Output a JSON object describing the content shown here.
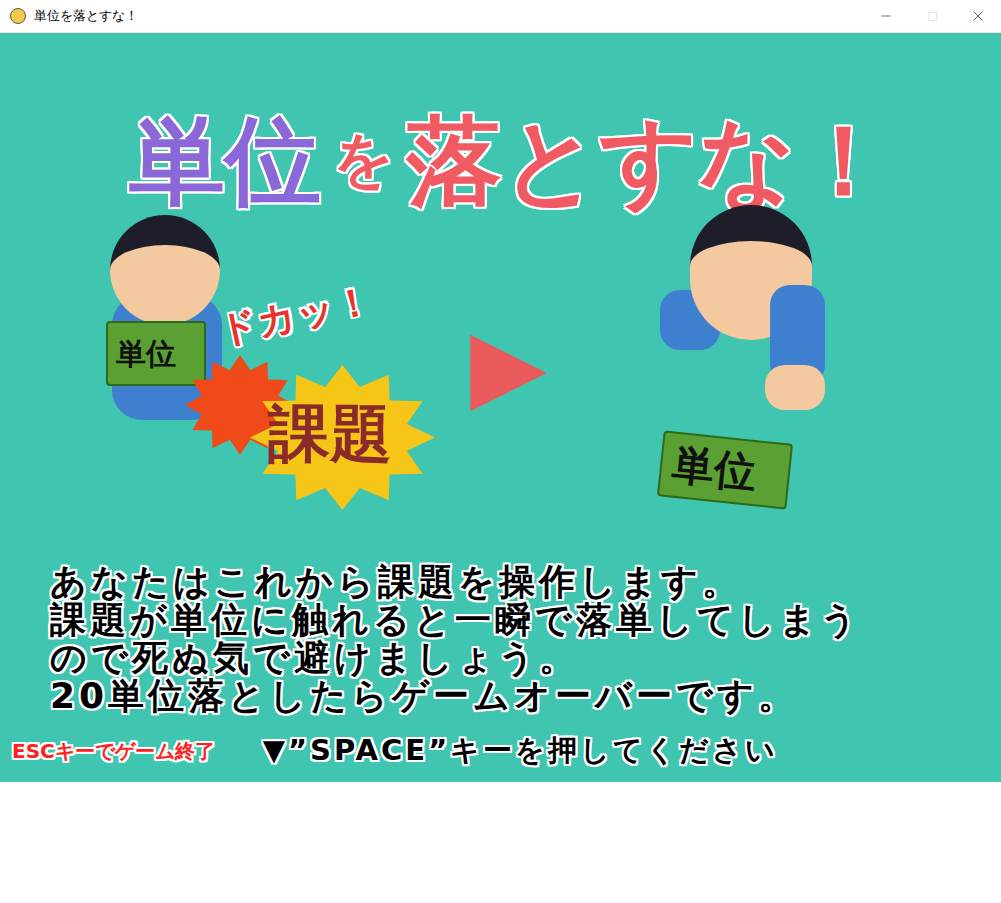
{
  "window": {
    "title": "単位を落とすな！"
  },
  "title": {
    "parts": [
      {
        "text": "単位",
        "color": "#8b68d8",
        "kind": "large"
      },
      {
        "text": "を",
        "color": "#ef5a63",
        "kind": "small"
      },
      {
        "text": "落とすな！",
        "color": "#ef5a63",
        "kind": "large"
      }
    ]
  },
  "illustration": {
    "left": {
      "card": "単位",
      "impact": "ドカッ！",
      "assignment": "課題"
    },
    "arrow": "▶",
    "right": {
      "card": "単位"
    }
  },
  "instructions": [
    "あなたはこれから課題を操作します。",
    "課題が単位に触れると一瞬で落単してしまう",
    "ので死ぬ気で避けましょう。",
    "20単位落としたらゲームオーバーです。"
  ],
  "footer": {
    "quit": "ESCキーでゲーム終了",
    "prompt": "▼”SPACE”キーを押してください"
  }
}
